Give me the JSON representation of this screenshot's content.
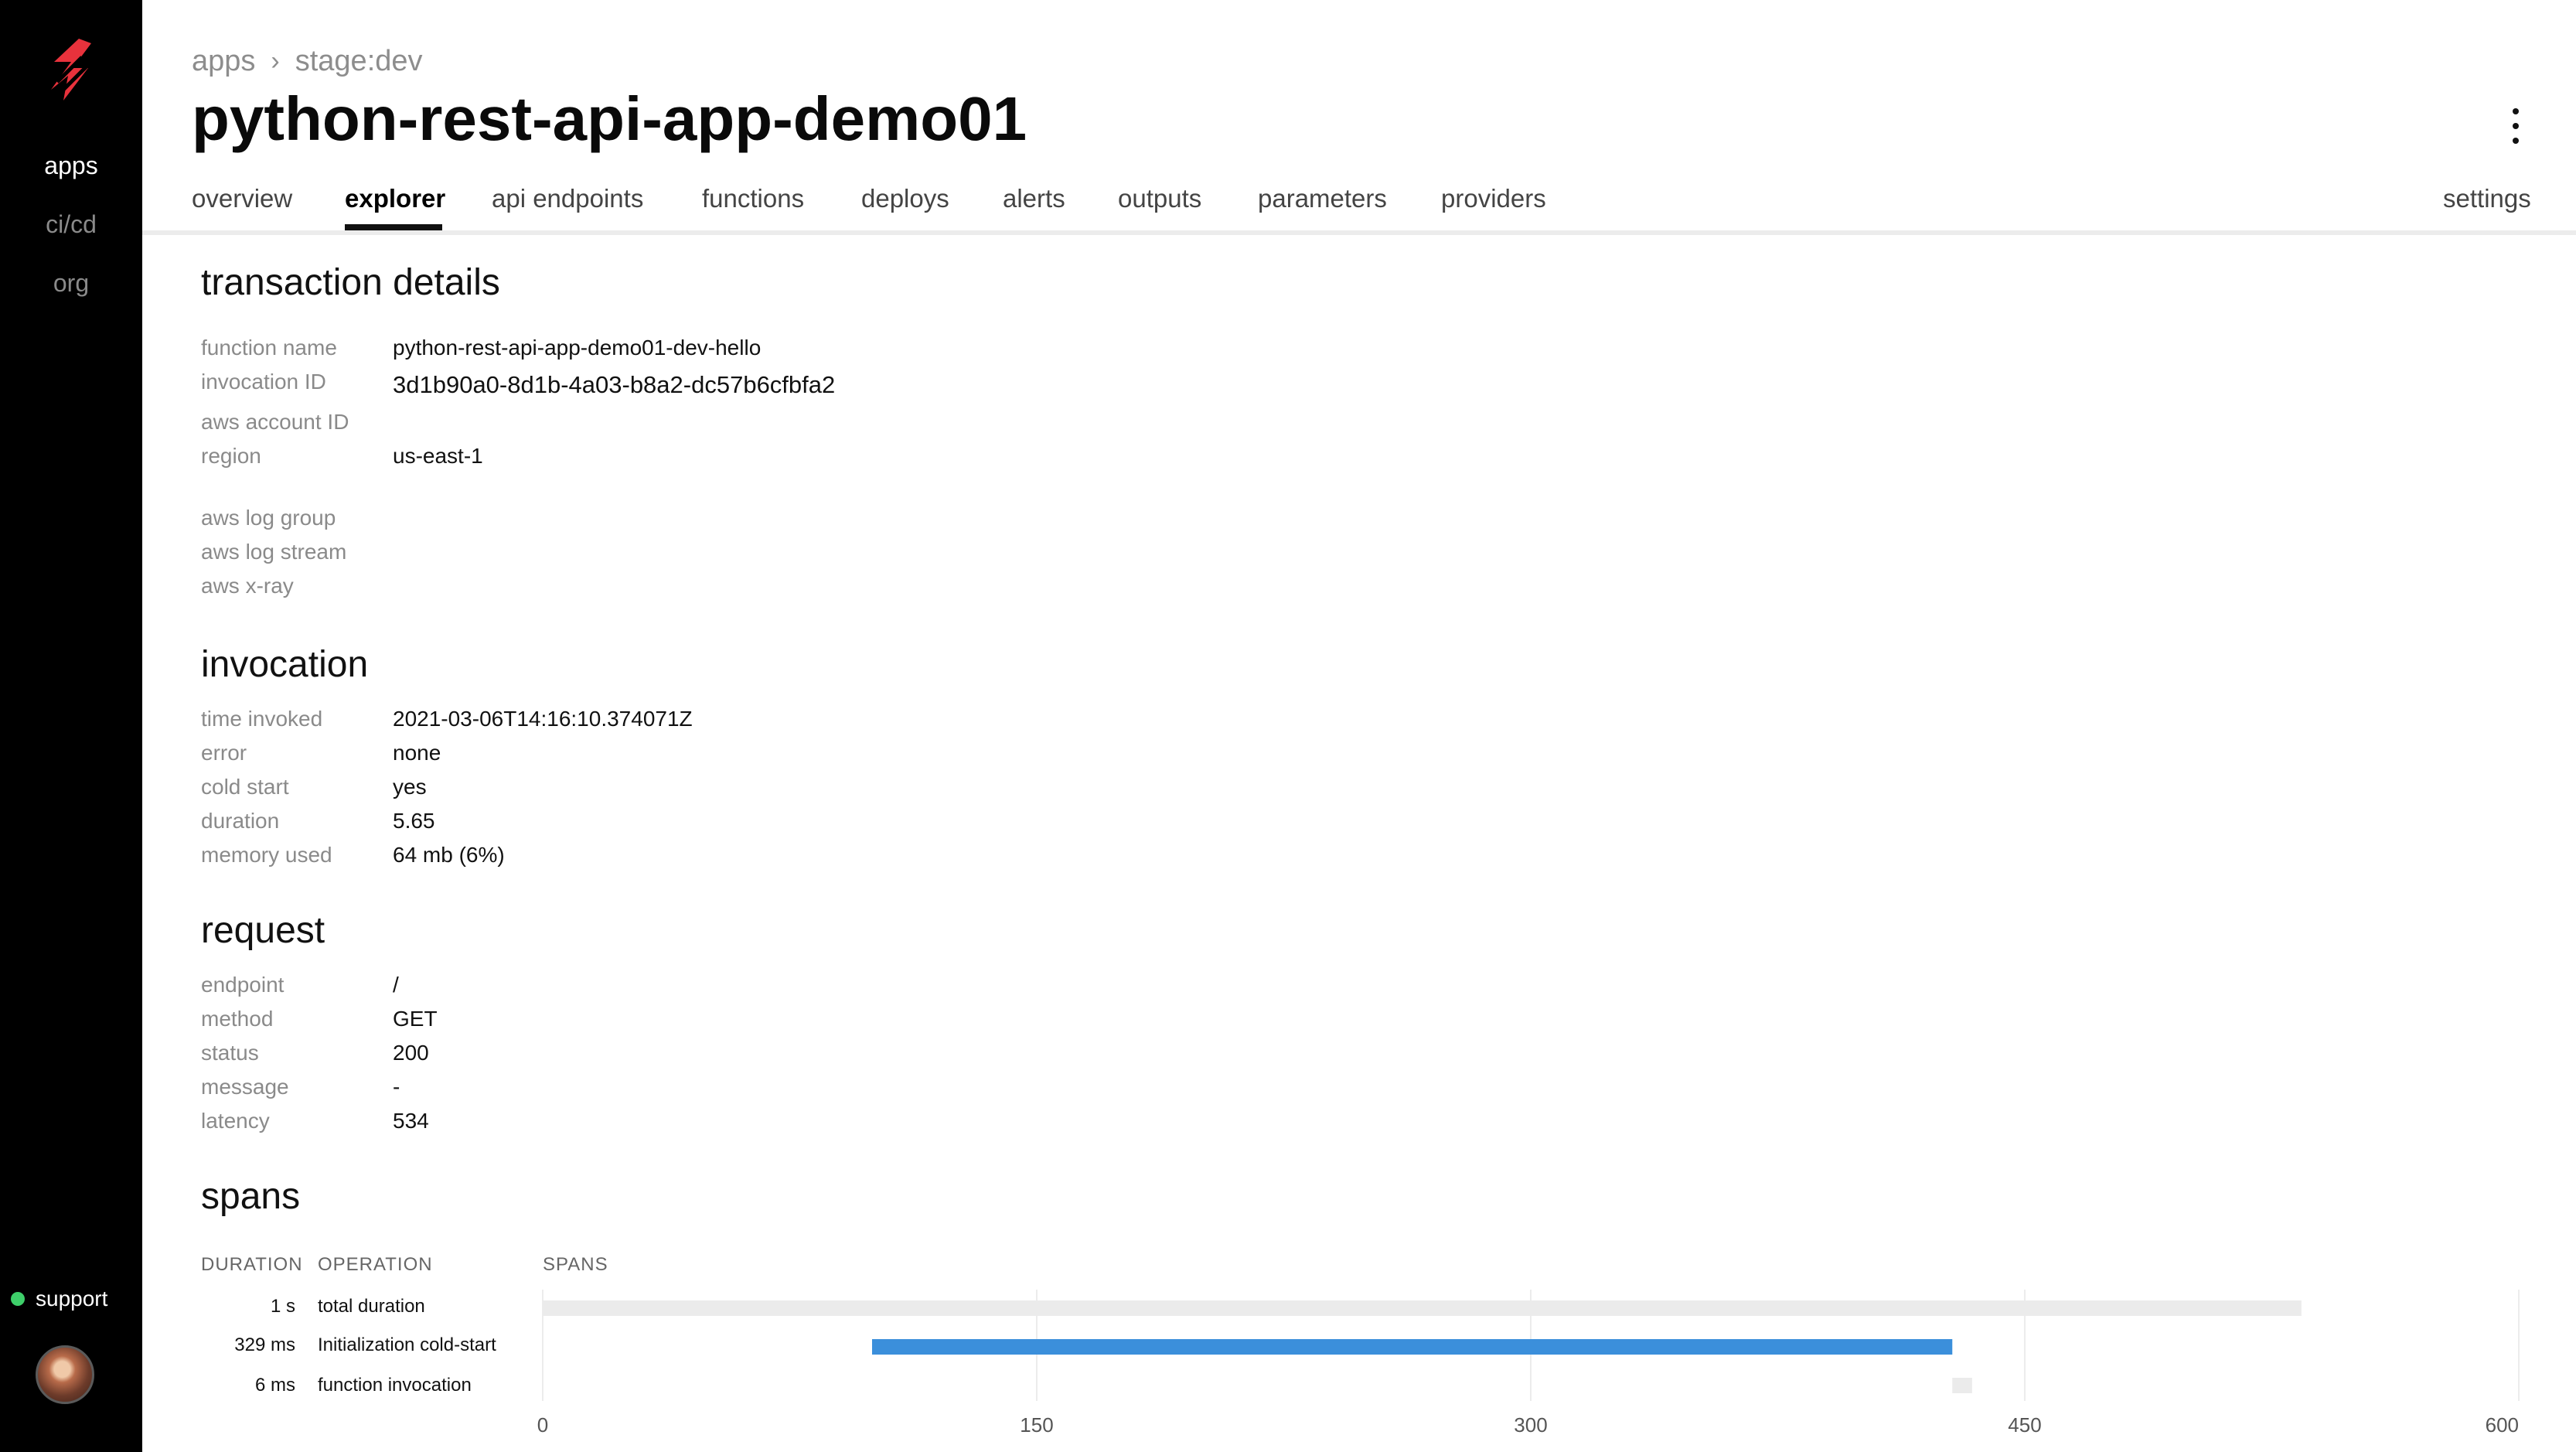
{
  "sidebar": {
    "nav": [
      "apps",
      "ci/cd",
      "org"
    ],
    "support_label": "support",
    "support_status_color": "#3ecf6a",
    "logo_icon": "bolt-logo-icon"
  },
  "header": {
    "breadcrumb": [
      "apps",
      "stage:dev"
    ],
    "title": "python-rest-api-app-demo01",
    "menu_icon": "more-vertical-icon"
  },
  "tabs": {
    "items": [
      "overview",
      "explorer",
      "api endpoints",
      "functions",
      "deploys",
      "alerts",
      "outputs",
      "parameters",
      "providers"
    ],
    "active": "explorer",
    "settings_label": "settings"
  },
  "transaction": {
    "title": "transaction details",
    "rows": [
      {
        "label": "function name",
        "value": "python-rest-api-app-demo01-dev-hello"
      },
      {
        "label": "invocation ID",
        "value": "3d1b90a0-8d1b-4a03-b8a2-dc57b6cfbfa2"
      },
      {
        "label": "aws account ID",
        "value": ""
      },
      {
        "label": "region",
        "value": "us-east-1"
      },
      {
        "label": "aws log group",
        "value": ""
      },
      {
        "label": "aws log stream",
        "value": ""
      },
      {
        "label": "aws x-ray",
        "value": ""
      }
    ]
  },
  "invocation": {
    "title": "invocation",
    "rows": [
      {
        "label": "time invoked",
        "value": "2021-03-06T14:16:10.374071Z"
      },
      {
        "label": "error",
        "value": "none"
      },
      {
        "label": "cold start",
        "value": "yes"
      },
      {
        "label": "duration",
        "value": "5.65"
      },
      {
        "label": "memory used",
        "value": "64 mb (6%)"
      }
    ]
  },
  "request": {
    "title": "request",
    "rows": [
      {
        "label": "endpoint",
        "value": "/"
      },
      {
        "label": "method",
        "value": "GET"
      },
      {
        "label": "status",
        "value": "200"
      },
      {
        "label": "message",
        "value": "-"
      },
      {
        "label": "latency",
        "value": "534"
      }
    ]
  },
  "spans": {
    "title": "spans",
    "headers": {
      "duration": "DURATION",
      "operation": "OPERATION",
      "spans": "SPANS"
    },
    "rows": [
      {
        "duration": "1 s",
        "operation": "total duration"
      },
      {
        "duration": "329 ms",
        "operation": "Initialization cold-start"
      },
      {
        "duration": "6 ms",
        "operation": "function invocation"
      }
    ]
  },
  "chart_data": {
    "type": "bar",
    "orientation": "horizontal",
    "x_ticks": [
      "0",
      "150",
      "300",
      "450",
      "600"
    ],
    "xlim": [
      0,
      600
    ],
    "grid": true,
    "categories": [
      "total duration",
      "Initialization cold-start",
      "function invocation"
    ],
    "bars": [
      {
        "start": 0,
        "end": 534,
        "color": "#ebebeb"
      },
      {
        "start": 100,
        "end": 428,
        "color": "#3b8fdb"
      },
      {
        "start": 428,
        "end": 434,
        "color": "#ebebeb"
      }
    ]
  },
  "colors": {
    "accent": "#e8323c",
    "active_tab": "#111111",
    "span_highlight": "#3b8fdb",
    "span_track": "#ebebeb"
  }
}
